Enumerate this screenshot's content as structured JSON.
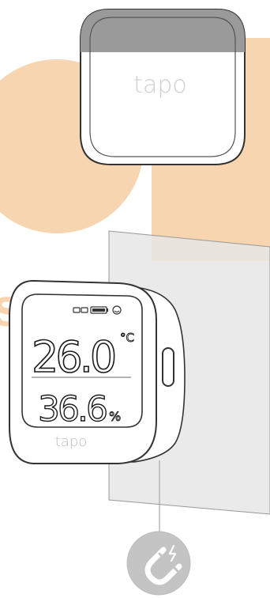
{
  "watermark": {
    "text": "smart",
    "color": "#f6d5b0"
  },
  "hub_device": {
    "brand": "tapo"
  },
  "sensor_device": {
    "brand": "tapo",
    "temperature": "26.0",
    "temperature_unit": "°C",
    "humidity": "36.6",
    "humidity_unit": "%"
  },
  "icons": [
    "link-icon",
    "battery-icon",
    "comfort-face-icon",
    "magnet-icon"
  ],
  "colors": {
    "watermark": "#f6d5b0",
    "wall_panel": "#e6e6e6",
    "outline": "#333333",
    "device_body": "#ffffff",
    "hub_top_shade": "#9a9a9a",
    "magnet_badge": "#c4c4c4"
  }
}
